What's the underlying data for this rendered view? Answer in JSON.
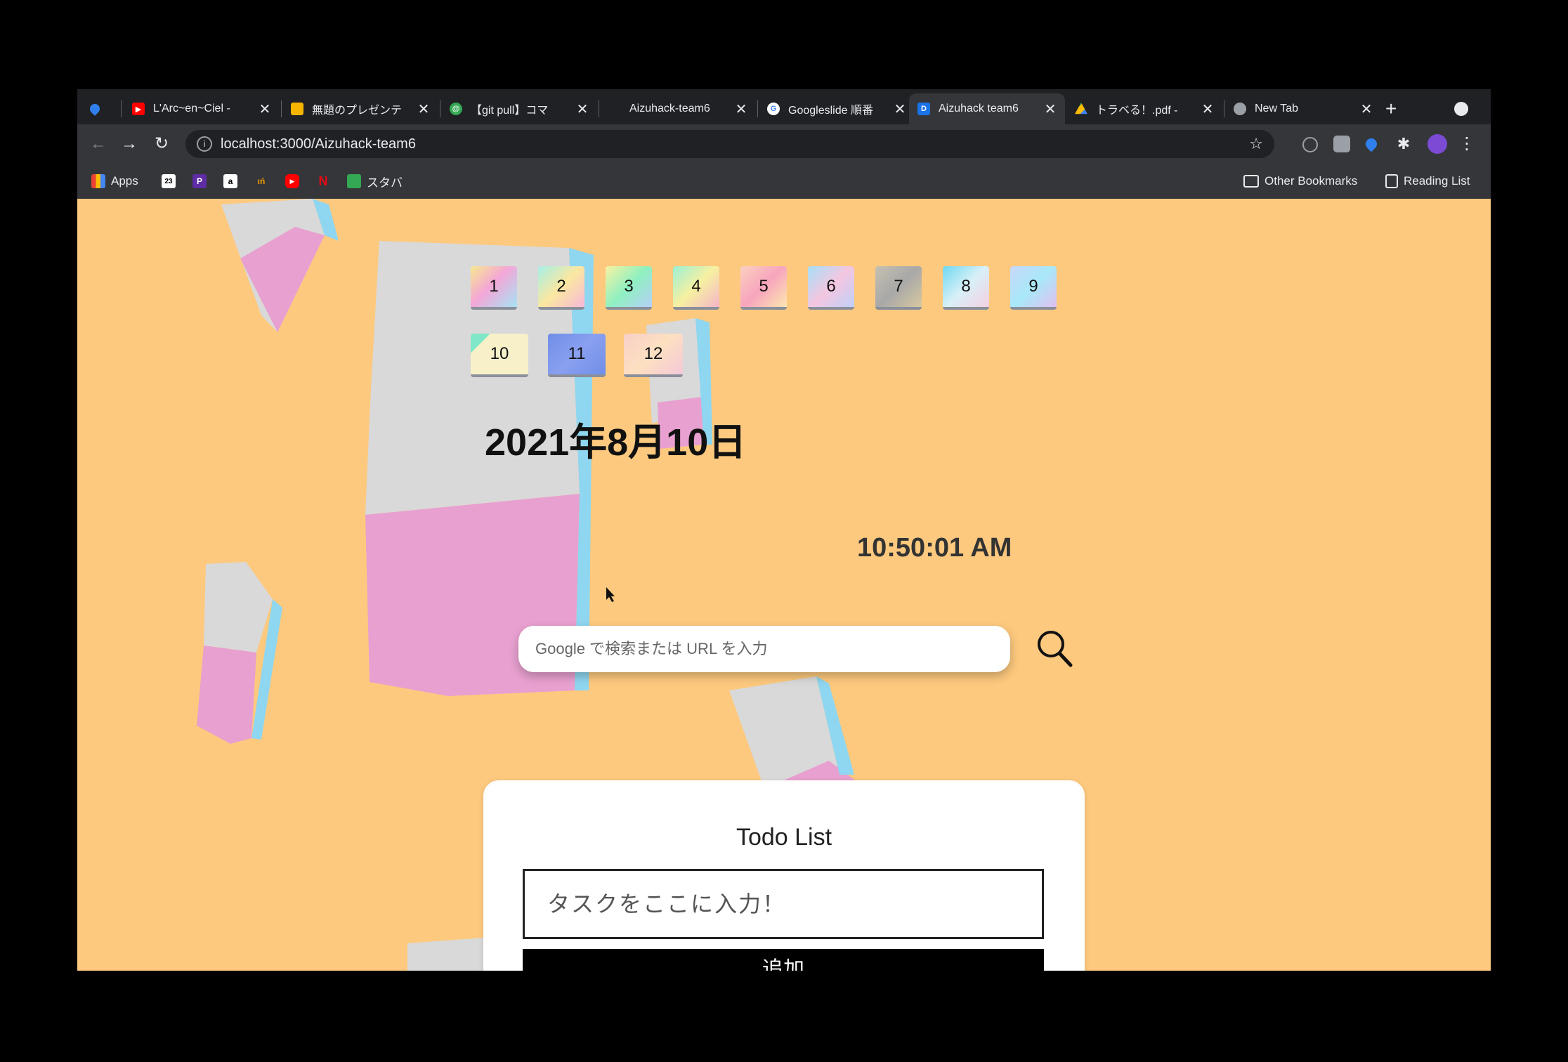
{
  "browser": {
    "tabs": [
      {
        "title": "",
        "favicon_color": "#2f80ed"
      },
      {
        "title": "L'Arc~en~Ciel -",
        "favicon_color": "#ff0000"
      },
      {
        "title": "無題のプレゼンテ",
        "favicon_color": "#f4b400"
      },
      {
        "title": "【git pull】コマ",
        "favicon_color": "#34a853"
      },
      {
        "title": "Aizuhack-team6",
        "favicon_color": "#202124"
      },
      {
        "title": "Googleslide 順番",
        "favicon_color": "#ffffff"
      },
      {
        "title": "Aizuhack team6",
        "favicon_color": "#1a73e8",
        "active": true
      },
      {
        "title": "トラベる！.pdf -",
        "favicon_color": "#fbbc04"
      },
      {
        "title": "New Tab",
        "favicon_color": "#9aa0a6"
      }
    ],
    "url": "localhost:3000/Aizuhack-team6",
    "bookmarks": {
      "apps_label": "Apps",
      "starba_label": "スタバ",
      "other_bookmarks": "Other Bookmarks",
      "reading_list": "Reading List"
    }
  },
  "page": {
    "months": [
      "1",
      "2",
      "3",
      "4",
      "5",
      "6",
      "7",
      "8",
      "9",
      "10",
      "11",
      "12"
    ],
    "date": "2021年8月10日",
    "time": "10:50:01 AM",
    "search_placeholder": "Google で検索または URL を入力",
    "todo": {
      "title": "Todo List",
      "input_placeholder": "タスクをここに入力！",
      "add_button": "追加"
    }
  },
  "colors": {
    "page_background": "#fdc97e",
    "shape_gray": "#d9d9d9",
    "shape_pink": "#e8a0d0",
    "shape_blue": "#8fd6f0"
  }
}
